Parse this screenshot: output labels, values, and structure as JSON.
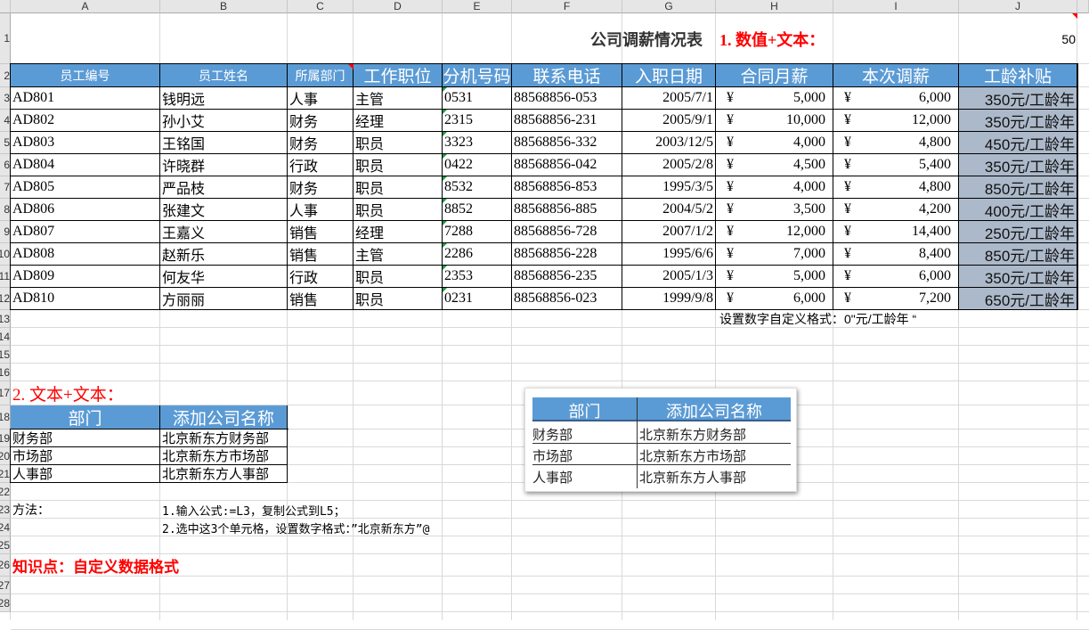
{
  "columns": [
    "A",
    "B",
    "C",
    "D",
    "E",
    "F",
    "G",
    "H",
    "I",
    "J"
  ],
  "rows": [
    "1",
    "2",
    "3",
    "4",
    "5",
    "6",
    "7",
    "8",
    "9",
    "10",
    "11",
    "12",
    "13",
    "14",
    "15",
    "16",
    "17",
    "18",
    "19",
    "20",
    "21",
    "22",
    "23",
    "24",
    "25",
    "26",
    "27",
    "28"
  ],
  "title": "公司调薪情况表",
  "section1": "1. 数值+文本：",
  "j1_value": "50",
  "headers": [
    "员工编号",
    "员工姓名",
    "所属部门",
    "工作职位",
    "分机号码",
    "联系电话",
    "入职日期",
    "合同月薪",
    "本次调薪",
    "工龄补贴"
  ],
  "currency": "¥",
  "employees": [
    [
      "AD801",
      "钱明远",
      "人事",
      "主管",
      "0531",
      "88568856-053",
      "2005/7/1",
      "5,000",
      "6,000",
      "350元/工龄年"
    ],
    [
      "AD802",
      "孙小艾",
      "财务",
      "经理",
      "2315",
      "88568856-231",
      "2005/9/1",
      "10,000",
      "12,000",
      "350元/工龄年"
    ],
    [
      "AD803",
      "王铭国",
      "财务",
      "职员",
      "3323",
      "88568856-332",
      "2003/12/5",
      "4,000",
      "4,800",
      "450元/工龄年"
    ],
    [
      "AD804",
      "许晓群",
      "行政",
      "职员",
      "0422",
      "88568856-042",
      "2005/2/8",
      "4,500",
      "5,400",
      "350元/工龄年"
    ],
    [
      "AD805",
      "严品枝",
      "财务",
      "职员",
      "8532",
      "88568856-853",
      "1995/3/5",
      "4,000",
      "4,800",
      "850元/工龄年"
    ],
    [
      "AD806",
      "张建文",
      "人事",
      "职员",
      "8852",
      "88568856-885",
      "2004/5/2",
      "3,500",
      "4,200",
      "400元/工龄年"
    ],
    [
      "AD807",
      "王嘉义",
      "销售",
      "经理",
      "7288",
      "88568856-728",
      "2007/1/2",
      "12,000",
      "14,400",
      "250元/工龄年"
    ],
    [
      "AD808",
      "赵新乐",
      "销售",
      "主管",
      "2286",
      "88568856-228",
      "1995/6/6",
      "7,000",
      "8,400",
      "850元/工龄年"
    ],
    [
      "AD809",
      "何友华",
      "行政",
      "职员",
      "2353",
      "88568856-235",
      "2005/1/3",
      "5,000",
      "6,000",
      "350元/工龄年"
    ],
    [
      "AD810",
      "方丽丽",
      "销售",
      "职员",
      "0231",
      "88568856-023",
      "1999/9/8",
      "6,000",
      "7,200",
      "650元/工龄年"
    ]
  ],
  "format_note": "设置数字自定义格式：0\"元/工龄年 “",
  "section2": "2. 文本+文本：",
  "dept_headers": [
    "部门",
    "添加公司名称"
  ],
  "depts": [
    [
      "财务部",
      "北京新东方财务部"
    ],
    [
      "市场部",
      "北京新东方市场部"
    ],
    [
      "人事部",
      "北京新东方人事部"
    ]
  ],
  "method_label": "方法：",
  "method_steps": [
    "1.输入公式:=L3，复制公式到L5；",
    "2.选中这3个单元格，设置数字格式：”北京新东方”@"
  ],
  "knowledge": "知识点：自定义数据格式",
  "picture": {
    "headers": [
      "部门",
      "添加公司名称"
    ],
    "rows": [
      [
        "财务部",
        "北京新东方财务部"
      ],
      [
        "市场部",
        "北京新东方市场部"
      ],
      [
        "人事部",
        "北京新东方人事部"
      ]
    ]
  }
}
